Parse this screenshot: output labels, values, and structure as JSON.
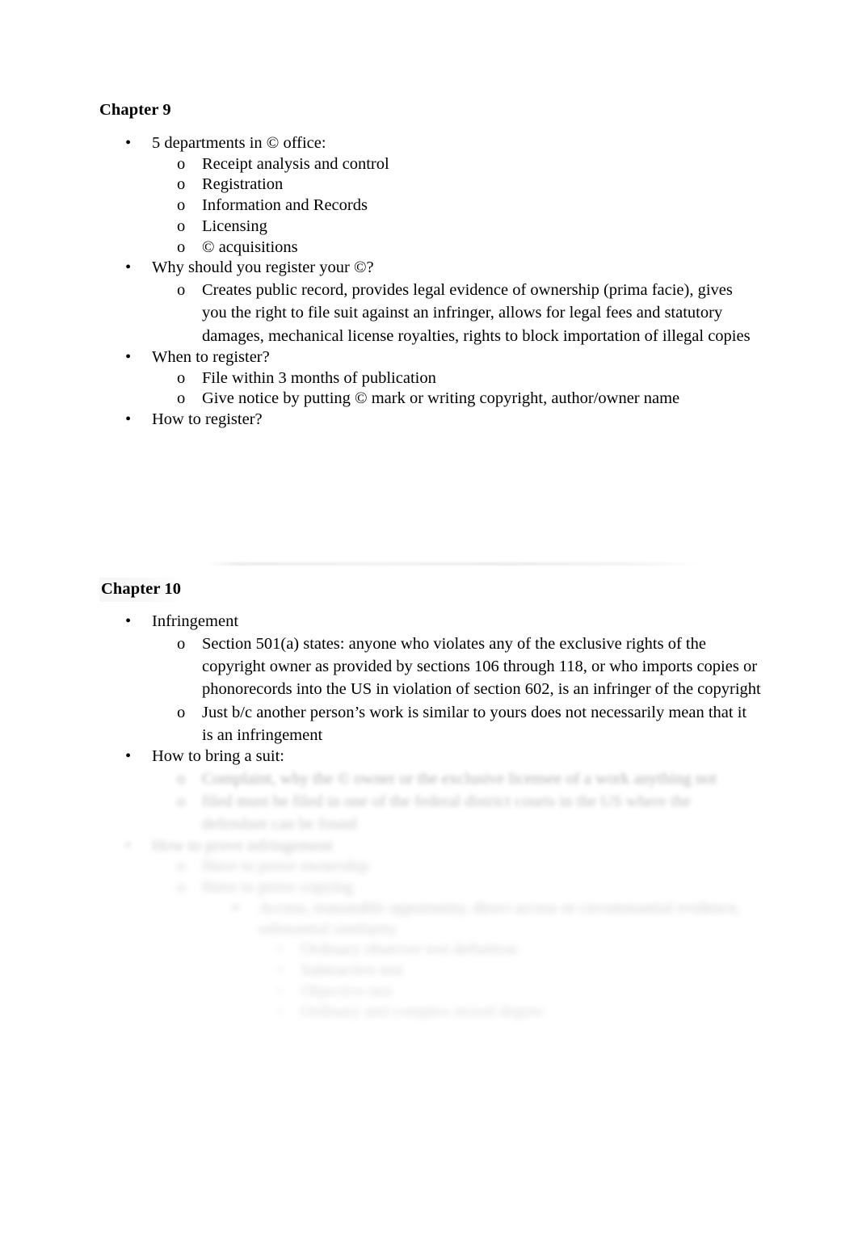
{
  "document": {
    "background_color": "#ffffff",
    "text_color": "#000000"
  },
  "chapter9": {
    "heading": "Chapter 9",
    "items": [
      {
        "level": 1,
        "marker": "bullet-disc",
        "text": "5 departments in © office:"
      },
      {
        "level": 2,
        "marker": "bullet-circle",
        "text": "Receipt analysis and control"
      },
      {
        "level": 2,
        "marker": "bullet-circle",
        "text": "Registration"
      },
      {
        "level": 2,
        "marker": "bullet-circle",
        "text": "Information and Records"
      },
      {
        "level": 2,
        "marker": "bullet-circle",
        "text": "Licensing"
      },
      {
        "level": 2,
        "marker": "bullet-circle",
        "text": "© acquisitions"
      },
      {
        "level": 1,
        "marker": "bullet-disc",
        "text": "Why should you register your ©?"
      },
      {
        "level": 2,
        "marker": "bullet-circle",
        "text": "Creates public record, provides legal evidence of ownership (prima facie), gives you the right to file suit against an infringer, allows for legal fees and statutory damages, mechanical license royalties, rights to block importation of illegal copies"
      },
      {
        "level": 1,
        "marker": "bullet-disc",
        "text": "When to register?"
      },
      {
        "level": 2,
        "marker": "bullet-circle",
        "text": "File within 3 months of publication"
      },
      {
        "level": 2,
        "marker": "bullet-circle",
        "text": "Give notice by putting © mark or writing copyright, author/owner name"
      },
      {
        "level": 1,
        "marker": "bullet-disc",
        "text": "How to register?"
      }
    ]
  },
  "chapter10": {
    "heading": "Chapter 10",
    "items": [
      {
        "level": 1,
        "marker": "bullet-disc",
        "text": "Infringement"
      },
      {
        "level": 2,
        "marker": "bullet-circle",
        "text": "Section 501(a) states: anyone who violates any of the exclusive rights of the copyright owner as provided by sections 106 through 118, or who imports copies or phonorecords into the US in violation of section 602, is an infringer of the copyright"
      },
      {
        "level": 2,
        "marker": "bullet-circle",
        "text": "Just b/c another person’s work is similar to yours does not necessarily mean that it is an infringement"
      },
      {
        "level": 1,
        "marker": "bullet-disc",
        "text": "How to bring a suit:"
      }
    ],
    "degraded_items": [
      {
        "level": 2,
        "marker": "bullet-circle",
        "legible": false,
        "note": "illegible faded text, approx. 3 wrapped lines"
      },
      {
        "level": 1,
        "marker": "bullet-disc",
        "legible": false,
        "note": "illegible faded text, one line"
      },
      {
        "level": 2,
        "marker": "bullet-circle",
        "legible": false,
        "note": "illegible faded text, one line"
      },
      {
        "level": 2,
        "marker": "bullet-circle",
        "legible": false,
        "note": "illegible faded text, one line"
      },
      {
        "level": 3,
        "marker": "bullet-square",
        "legible": false,
        "note": "illegible faded text, approx. 2 wrapped lines"
      },
      {
        "level": 4,
        "marker": "bullet-dash",
        "legible": false,
        "note": "illegible faded text, one line"
      },
      {
        "level": 4,
        "marker": "bullet-dash",
        "legible": false,
        "note": "illegible faded text, one line"
      },
      {
        "level": 4,
        "marker": "bullet-dash",
        "legible": false,
        "note": "illegible faded text, one line"
      },
      {
        "level": 4,
        "marker": "bullet-dash",
        "legible": false,
        "note": "illegible faded text, one line"
      }
    ]
  },
  "markers": {
    "bullet-disc": "•",
    "bullet-circle": "o",
    "bullet-square": "▪",
    "bullet-dash": "▫"
  },
  "artifacts": {
    "page_break_line": "faint horizontal smudge above Chapter 10 heading",
    "heading_shading": "faint grey shading behind Chapter 10 heading"
  },
  "degraded_placeholder": {
    "line_a1": "Complaint, why the © owner or the exclusive licensee of a work anything not",
    "line_a2": "filed must be filed in one of the federal district courts in the US where the",
    "line_a3": "defendant can be found",
    "line_b": "How to prove infringement",
    "line_c1": "Have to prove ownership",
    "line_c2": "Have to prove copying",
    "line_d1": "Access, reasonable opportunity, direct access or circumstantial evidence,",
    "line_d2": "substantial similarity",
    "line_e1": "Ordinary observer test definition",
    "line_e2": "Subtractive test",
    "line_e3": "Objective test",
    "line_e4": "Ordinary and complex mixed degree"
  }
}
